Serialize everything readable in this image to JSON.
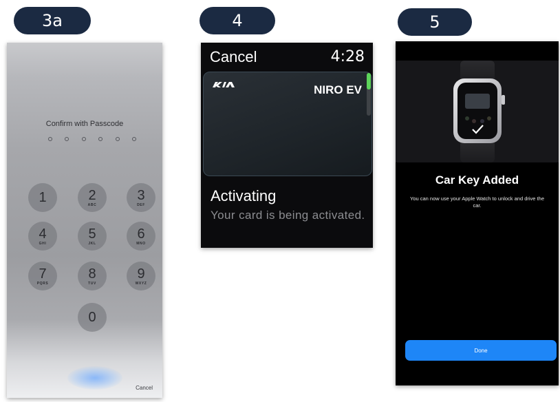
{
  "steps": {
    "step_3a": "3a",
    "step_4": "4",
    "step_5": "5"
  },
  "passcode_screen": {
    "title": "Confirm with Passcode",
    "digits_required": 6,
    "keys": [
      {
        "num": "1",
        "letters": ""
      },
      {
        "num": "2",
        "letters": "ABC"
      },
      {
        "num": "3",
        "letters": "DEF"
      },
      {
        "num": "4",
        "letters": "GHI"
      },
      {
        "num": "5",
        "letters": "JKL"
      },
      {
        "num": "6",
        "letters": "MNO"
      },
      {
        "num": "7",
        "letters": "PQRS"
      },
      {
        "num": "8",
        "letters": "TUV"
      },
      {
        "num": "9",
        "letters": "WXYZ"
      },
      {
        "num": "0",
        "letters": ""
      }
    ],
    "cancel_label": "Cancel"
  },
  "watch_screen": {
    "cancel_label": "Cancel",
    "time": "4:28",
    "card_brand": "KIA logo",
    "card_name": "NIRO EV",
    "status_title": "Activating",
    "status_desc": "Your card is being activated."
  },
  "added_screen": {
    "title": "Car Key Added",
    "description": "You can now use your Apple Watch to unlock and drive the car.",
    "done_label": "Done"
  },
  "colors": {
    "pill_bg": "#1b2a42",
    "scroll_indicator": "#5cd35a",
    "done_button": "#1e86f7"
  }
}
